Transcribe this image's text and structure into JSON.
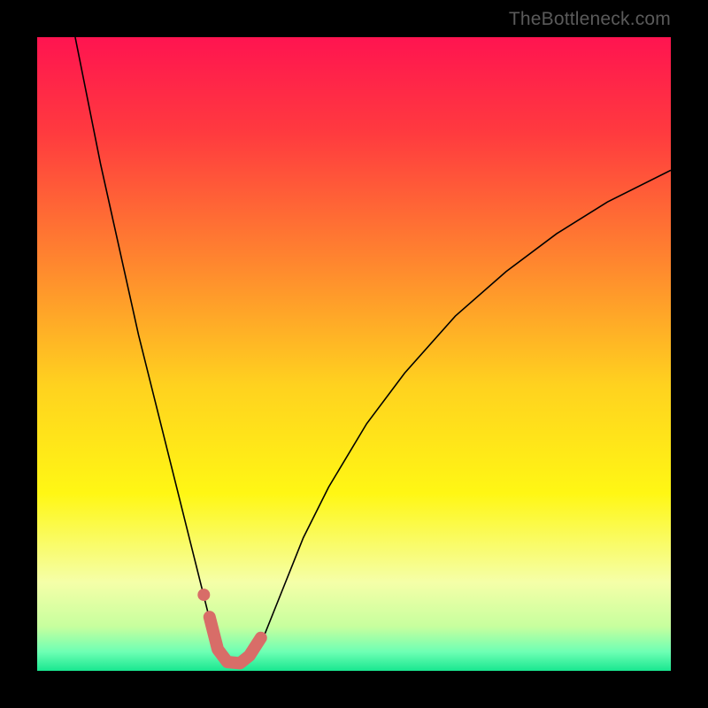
{
  "watermark": "TheBottleneck.com",
  "chart_data": {
    "type": "line",
    "title": "",
    "xlabel": "",
    "ylabel": "",
    "xlim": [
      0,
      100
    ],
    "ylim": [
      0,
      100
    ],
    "background": {
      "type": "vertical-gradient",
      "stops": [
        {
          "offset": 0,
          "color": "#ff1450"
        },
        {
          "offset": 0.15,
          "color": "#ff3a3f"
        },
        {
          "offset": 0.35,
          "color": "#ff842f"
        },
        {
          "offset": 0.55,
          "color": "#ffd21f"
        },
        {
          "offset": 0.72,
          "color": "#fff714"
        },
        {
          "offset": 0.86,
          "color": "#f5ffa8"
        },
        {
          "offset": 0.93,
          "color": "#c7ff9e"
        },
        {
          "offset": 0.97,
          "color": "#6effb4"
        },
        {
          "offset": 1.0,
          "color": "#19e790"
        }
      ]
    },
    "series": [
      {
        "name": "bottleneck-curve",
        "color": "#000000",
        "width": 1.6,
        "x": [
          6,
          8,
          10,
          12,
          14,
          16,
          18,
          20,
          22,
          24,
          26,
          27,
          28,
          29,
          30,
          31,
          32,
          33,
          34,
          36,
          38,
          42,
          46,
          52,
          58,
          66,
          74,
          82,
          90,
          100
        ],
        "y": [
          100,
          90,
          80,
          71,
          62,
          53,
          45,
          37,
          29,
          21,
          13,
          9,
          5.5,
          3,
          1.5,
          1,
          1,
          1.3,
          2.4,
          6,
          11,
          21,
          29,
          39,
          47,
          56,
          63,
          69,
          74,
          79
        ]
      },
      {
        "name": "highlight-band",
        "type": "marker-line",
        "color": "#d86d68",
        "width": 14,
        "linecap": "round",
        "points": [
          {
            "x": 27.2,
            "y": 8.5
          },
          {
            "x": 28.5,
            "y": 3.4
          },
          {
            "x": 30.0,
            "y": 1.4
          },
          {
            "x": 32.0,
            "y": 1.2
          },
          {
            "x": 33.5,
            "y": 2.4
          },
          {
            "x": 35.3,
            "y": 5.2
          }
        ]
      },
      {
        "name": "highlight-dot",
        "type": "marker",
        "color": "#d86d68",
        "radius": 7,
        "points": [
          {
            "x": 26.3,
            "y": 12.0
          }
        ]
      }
    ]
  }
}
